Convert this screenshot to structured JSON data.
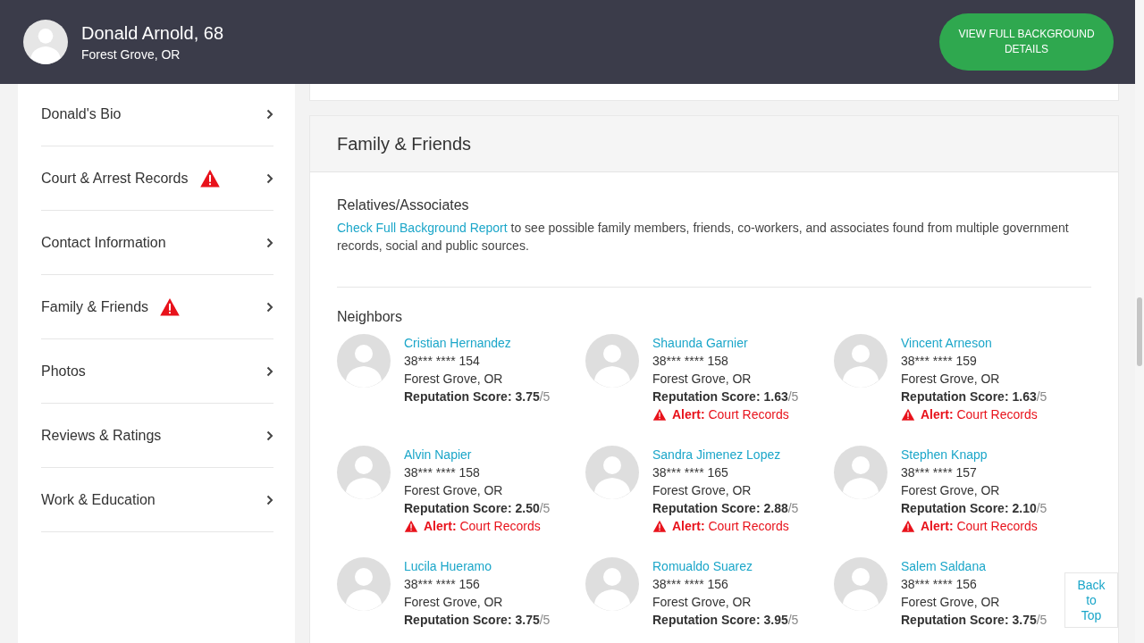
{
  "header": {
    "name": "Donald Arnold, 68",
    "location": "Forest Grove, OR",
    "button": "VIEW FULL BACKGROUND DETAILS"
  },
  "sidebar": {
    "items": [
      {
        "label": "Donald's Bio",
        "alert": false
      },
      {
        "label": "Court & Arrest Records",
        "alert": true
      },
      {
        "label": "Contact Information",
        "alert": false
      },
      {
        "label": "Family & Friends",
        "alert": true
      },
      {
        "label": "Photos",
        "alert": false
      },
      {
        "label": "Reviews & Ratings",
        "alert": false
      },
      {
        "label": "Work & Education",
        "alert": false
      }
    ]
  },
  "family_card": {
    "title": "Family & Friends",
    "relatives_heading": "Relatives/Associates",
    "relatives_link": "Check Full Background Report",
    "relatives_text": " to see possible family members, friends, co-workers, and associates found from multiple government records, social and public sources.",
    "neighbors_heading": "Neighbors",
    "neighbors": [
      {
        "name": "Cristian Hernandez",
        "phone": "38*** **** 154",
        "location": "Forest Grove, OR",
        "score_label": "Reputation Score:",
        "score": "3.75",
        "score_max": "/5",
        "alert": false
      },
      {
        "name": "Shaunda Garnier",
        "phone": "38*** **** 158",
        "location": "Forest Grove, OR",
        "score_label": "Reputation Score:",
        "score": "1.63",
        "score_max": "/5",
        "alert": true,
        "alert_label": "Alert:",
        "alert_text": "Court Records"
      },
      {
        "name": "Vincent Arneson",
        "phone": "38*** **** 159",
        "location": "Forest Grove, OR",
        "score_label": "Reputation Score:",
        "score": "1.63",
        "score_max": "/5",
        "alert": true,
        "alert_label": "Alert:",
        "alert_text": "Court Records"
      },
      {
        "name": "Alvin Napier",
        "phone": "38*** **** 158",
        "location": "Forest Grove, OR",
        "score_label": "Reputation Score:",
        "score": "2.50",
        "score_max": "/5",
        "alert": true,
        "alert_label": "Alert:",
        "alert_text": "Court Records"
      },
      {
        "name": "Sandra Jimenez Lopez",
        "phone": "38*** **** 165",
        "location": "Forest Grove, OR",
        "score_label": "Reputation Score:",
        "score": "2.88",
        "score_max": "/5",
        "alert": true,
        "alert_label": "Alert:",
        "alert_text": "Court Records"
      },
      {
        "name": "Stephen Knapp",
        "phone": "38*** **** 157",
        "location": "Forest Grove, OR",
        "score_label": "Reputation Score:",
        "score": "2.10",
        "score_max": "/5",
        "alert": true,
        "alert_label": "Alert:",
        "alert_text": "Court Records"
      },
      {
        "name": "Lucila Hueramo",
        "phone": "38*** **** 156",
        "location": "Forest Grove, OR",
        "score_label": "Reputation Score:",
        "score": "3.75",
        "score_max": "/5",
        "alert": false
      },
      {
        "name": "Romualdo Suarez",
        "phone": "38*** **** 156",
        "location": "Forest Grove, OR",
        "score_label": "Reputation Score:",
        "score": "3.95",
        "score_max": "/5",
        "alert": false
      },
      {
        "name": "Salem Saldana",
        "phone": "38*** **** 156",
        "location": "Forest Grove, OR",
        "score_label": "Reputation Score:",
        "score": "3.75",
        "score_max": "/5",
        "alert": false
      }
    ]
  },
  "back_to_top": [
    "Back",
    "to",
    "Top"
  ]
}
